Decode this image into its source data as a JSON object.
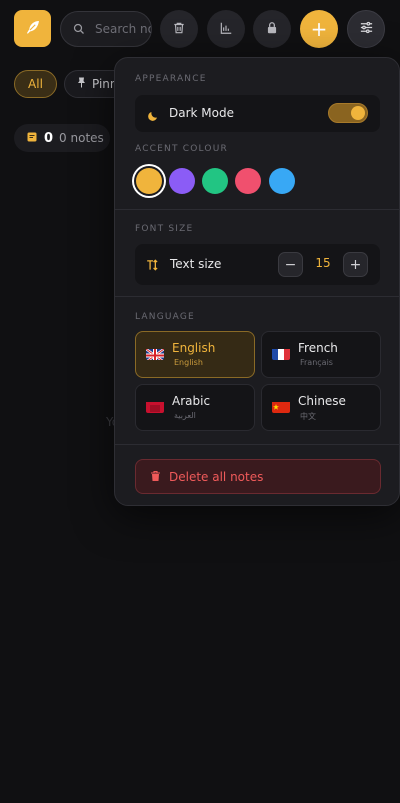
{
  "topbar": {
    "search_placeholder": "Search notes..."
  },
  "filters": [
    {
      "label": "All"
    },
    {
      "label": "Pinned"
    }
  ],
  "count": {
    "number": "0",
    "text": "0 notes"
  },
  "empty_hint": "Yo",
  "settings": {
    "appearance_label": "APPEARANCE",
    "dark_mode_label": "Dark Mode",
    "dark_mode_on": true,
    "accent_label": "ACCENT COLOUR",
    "accent_colors": [
      "#f0b43c",
      "#8b5cf6",
      "#22c583",
      "#f0506e",
      "#38a8f5"
    ],
    "accent_selected": 0,
    "font_size_label": "FONT SIZE",
    "text_size_label": "Text size",
    "text_size_value": "15",
    "stepper_minus": "−",
    "stepper_plus": "+",
    "language_label": "LANGUAGE",
    "languages": [
      {
        "name": "English",
        "native": "English",
        "flag": "uk-flag"
      },
      {
        "name": "French",
        "native": "Français",
        "flag": "france-flag"
      },
      {
        "name": "Arabic",
        "native": "العربية",
        "flag": "arabic-flag"
      },
      {
        "name": "Chinese",
        "native": "中文",
        "flag": "china-flag"
      }
    ],
    "language_selected": 0,
    "delete_label": "Delete all notes"
  },
  "colors": {
    "accent": "#f0b43c",
    "background": "#101012",
    "panel": "#1c1c20",
    "danger": "#ef5a5a"
  }
}
